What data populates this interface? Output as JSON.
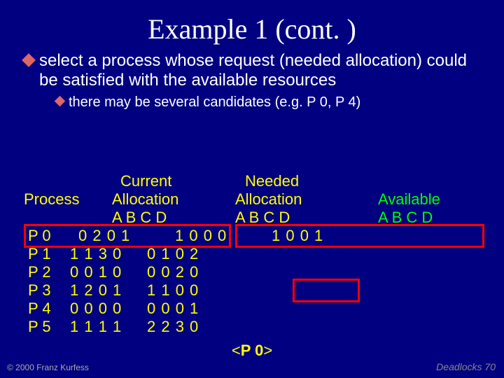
{
  "title": "Example 1 (cont. )",
  "bullet_main": "select a process whose request (needed allocation) could be satisfied with the available resources",
  "bullet_sub": "there may be several candidates (e.g. P 0, P 4)",
  "headers": {
    "process": "Process",
    "current1": "Current",
    "current2": "Allocation",
    "current3": "A B  C  D",
    "needed1": "Needed",
    "needed2": "Allocation",
    "needed3": "A  B  C  D",
    "available1": "Available",
    "available2": "A  B  C  D"
  },
  "rows": {
    "p0": {
      "name": "P 0",
      "cur": "0 2 0 1",
      "need": "1 0 0 0",
      "avail": "1 0 0 1"
    },
    "p1": {
      "name": "P 1",
      "cur": "1 1 3 0",
      "need": "0 1 0 2"
    },
    "p2": {
      "name": "P 2",
      "cur": "0 0 1 0",
      "need": "0 0 2 0"
    },
    "p3": {
      "name": "P 3",
      "cur": "1 2 0 1",
      "need": "1 1 0 0"
    },
    "p4": {
      "name": "P 4",
      "cur": "0 0 0 0",
      "need": "0 0 0 1"
    },
    "p5": {
      "name": "P 5",
      "cur": "1 1 1 1",
      "need": "2 2 3 0"
    }
  },
  "selected": {
    "lt": "<",
    "name": "P 0",
    "gt": ">"
  },
  "footer_left": "© 2000 Franz Kurfess",
  "footer_right": "Deadlocks  70"
}
